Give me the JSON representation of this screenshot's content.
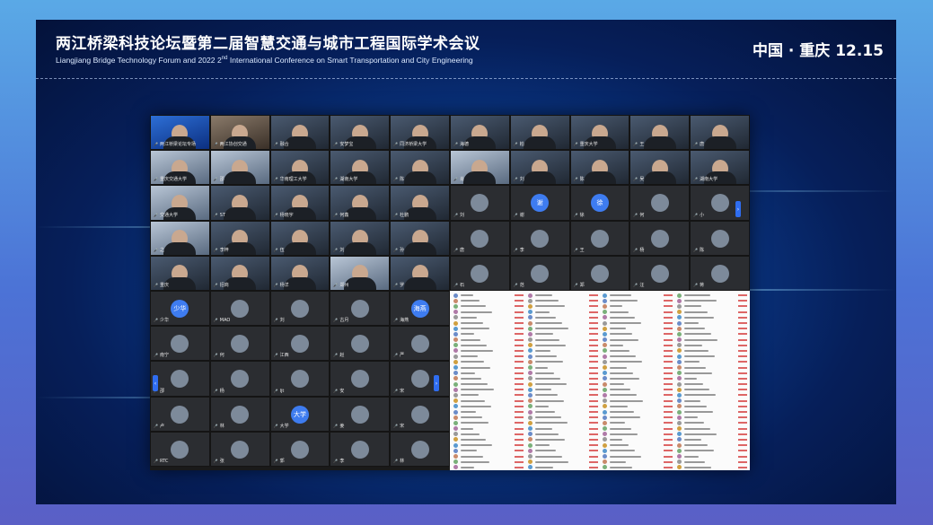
{
  "header": {
    "title_cn": "两江桥梁科技论坛暨第二届智慧交通与城市工程国际学术会议",
    "title_en_pre": "Liangjiang Bridge Technology Forum and 2022 2",
    "title_en_sup": "nd",
    "title_en_post": " International Conference on Smart Transportation and City Engineering",
    "place_date": "中国 · 重庆  12.15"
  },
  "colors": {
    "accent": "#2f6df0",
    "background": "#061f5a",
    "frame": "#4c73d6"
  },
  "meeting": {
    "video_tiles": [
      {
        "name": "两江桥梁论坛专场",
        "style": "video blue"
      },
      {
        "name": "两江协创交通",
        "style": "video warm"
      },
      {
        "name": "融合",
        "style": "video"
      },
      {
        "name": "安梦宝",
        "style": "video"
      },
      {
        "name": "同济桥梁大学",
        "style": "video"
      },
      {
        "name": "重庆交通大学",
        "style": "video light"
      },
      {
        "name": "邵",
        "style": "video light"
      },
      {
        "name": "华南理工大学",
        "style": "video"
      },
      {
        "name": "湖南大学",
        "style": "video"
      },
      {
        "name": "陈",
        "style": "video"
      },
      {
        "name": "交通大学",
        "style": "video light"
      },
      {
        "name": "ST",
        "style": "video"
      },
      {
        "name": "杨晓宇",
        "style": "video"
      },
      {
        "name": "何鑫",
        "style": "video"
      },
      {
        "name": "杜鹏",
        "style": "video"
      },
      {
        "name": "之",
        "style": "video light"
      },
      {
        "name": "李梓",
        "style": "video"
      },
      {
        "name": "伍",
        "style": "video"
      },
      {
        "name": "刘",
        "style": "video"
      },
      {
        "name": "孙",
        "style": "video"
      },
      {
        "name": "重庆",
        "style": "video"
      },
      {
        "name": "招商",
        "style": "video"
      },
      {
        "name": "杨洋",
        "style": "video"
      },
      {
        "name": "郑州",
        "style": "video light"
      },
      {
        "name": "罗",
        "style": "video"
      },
      {
        "name": "海德",
        "style": "video"
      },
      {
        "name": "柏",
        "style": "video"
      },
      {
        "name": "重庆大学",
        "style": "video"
      },
      {
        "name": "王",
        "style": "video"
      },
      {
        "name": "唐",
        "style": "video"
      },
      {
        "name": "肖",
        "style": "video light"
      },
      {
        "name": "刘",
        "style": "video"
      },
      {
        "name": "陈",
        "style": "video"
      },
      {
        "name": "吴",
        "style": "video"
      },
      {
        "name": "湖南大学",
        "style": "video"
      }
    ],
    "avatar_tiles": [
      {
        "name": "少华",
        "label": "少华"
      },
      {
        "name": "MAO",
        "label": ""
      },
      {
        "name": "刘",
        "label": ""
      },
      {
        "name": "古月",
        "label": ""
      },
      {
        "name": "海燕",
        "label": "海燕"
      },
      {
        "name": "南宁",
        "label": ""
      },
      {
        "name": "何",
        "label": ""
      },
      {
        "name": "江西",
        "label": ""
      },
      {
        "name": "赵",
        "label": ""
      },
      {
        "name": "严",
        "label": ""
      },
      {
        "name": "邵",
        "label": ""
      },
      {
        "name": "杨",
        "label": ""
      },
      {
        "name": "ljt",
        "label": ""
      },
      {
        "name": "安",
        "label": ""
      },
      {
        "name": "宋",
        "label": ""
      },
      {
        "name": "卢",
        "label": ""
      },
      {
        "name": "林",
        "label": ""
      },
      {
        "name": "大学",
        "label": "大学"
      },
      {
        "name": "姜",
        "label": ""
      },
      {
        "name": "宋",
        "label": ""
      },
      {
        "name": "RTC",
        "label": ""
      },
      {
        "name": "张",
        "label": ""
      },
      {
        "name": "郭",
        "label": ""
      },
      {
        "name": "李",
        "label": ""
      },
      {
        "name": "林",
        "label": ""
      }
    ],
    "right_tiles": [
      {
        "name": "刘",
        "label": ""
      },
      {
        "name": "谢",
        "label": "谢"
      },
      {
        "name": "徐",
        "label": "徐"
      },
      {
        "name": "何",
        "label": ""
      },
      {
        "name": "小",
        "label": ""
      },
      {
        "name": "唐",
        "label": ""
      },
      {
        "name": "李",
        "label": ""
      },
      {
        "name": "王",
        "label": ""
      },
      {
        "name": "杨",
        "label": ""
      },
      {
        "name": "陈",
        "label": ""
      },
      {
        "name": "石",
        "label": ""
      },
      {
        "name": "范",
        "label": ""
      },
      {
        "name": "郑",
        "label": ""
      },
      {
        "name": "汪",
        "label": ""
      },
      {
        "name": "蒋",
        "label": ""
      },
      {
        "name": "L",
        "label": "L"
      },
      {
        "name": "钱",
        "label": ""
      }
    ]
  }
}
